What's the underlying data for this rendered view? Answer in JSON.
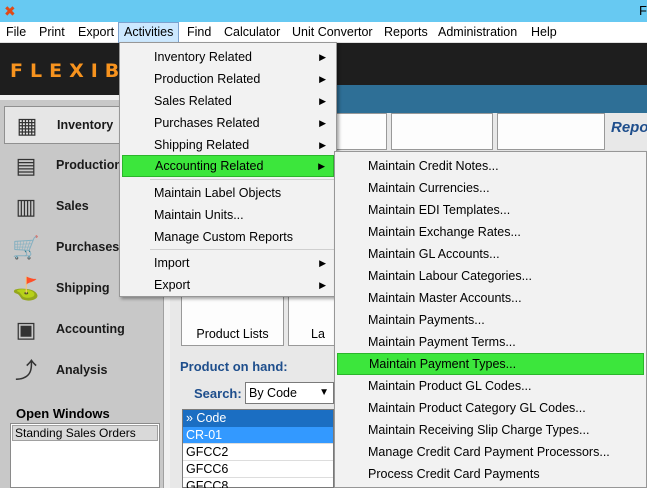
{
  "window": {
    "title_visible": "F"
  },
  "menubar": [
    "File",
    "Print",
    "Export",
    "Activities",
    "Find",
    "Calculator",
    "Unit Convertor",
    "Reports",
    "Administration",
    "Help"
  ],
  "logo": "FLEXIBA",
  "nav": [
    {
      "label": "Inventory",
      "icon": "barcode-icon"
    },
    {
      "label": "Production",
      "icon": "calendar-icon"
    },
    {
      "label": "Sales",
      "icon": "bar-chart-icon"
    },
    {
      "label": "Purchases",
      "icon": "cart-icon"
    },
    {
      "label": "Shipping",
      "icon": "map-pin-icon"
    },
    {
      "label": "Accounting",
      "icon": "calculator-icon"
    },
    {
      "label": "Analysis",
      "icon": "trend-icon"
    }
  ],
  "open_windows": {
    "title": "Open Windows",
    "items": [
      "Standing Sales Orders"
    ]
  },
  "main": {
    "report_label": "Repo",
    "tiles": [
      "Product Lists",
      "La"
    ],
    "product_on_hand": "Product on hand:",
    "search_label": "Search:",
    "search_value": "By Code",
    "grid_header": "» Code",
    "grid_rows": [
      "CR-01",
      "GFCC2",
      "GFCC6",
      "GFCC8"
    ]
  },
  "activities_menu": {
    "items": [
      {
        "label": "Inventory Related",
        "sub": true
      },
      {
        "label": "Production Related",
        "sub": true
      },
      {
        "label": "Sales Related",
        "sub": true
      },
      {
        "label": "Purchases Related",
        "sub": true
      },
      {
        "label": "Shipping Related",
        "sub": true
      },
      {
        "label": "Accounting Related",
        "sub": true
      },
      {
        "label": "Maintain Label Objects",
        "sub": false
      },
      {
        "label": "Maintain Units...",
        "sub": false
      },
      {
        "label": "Manage Custom Reports",
        "sub": false
      },
      {
        "label": "Import",
        "sub": true
      },
      {
        "label": "Export",
        "sub": true
      }
    ]
  },
  "accounting_submenu": {
    "items": [
      "Maintain Credit Notes...",
      "Maintain Currencies...",
      "Maintain EDI Templates...",
      "Maintain Exchange Rates...",
      "Maintain GL Accounts...",
      "Maintain Labour Categories...",
      "Maintain Master Accounts...",
      "Maintain Payments...",
      "Maintain Payment Terms...",
      "Maintain Payment Types...",
      "Maintain Product GL Codes...",
      "Maintain Product Category GL Codes...",
      "Maintain Receiving Slip Charge Types...",
      "Manage Credit Card Payment Processors...",
      "Process Credit Card Payments"
    ]
  },
  "colors": {
    "highlight": "#3ce63c",
    "titlebar": "#67c9f2",
    "logo": "#f7931e",
    "accent_text": "#1e4e8c"
  }
}
